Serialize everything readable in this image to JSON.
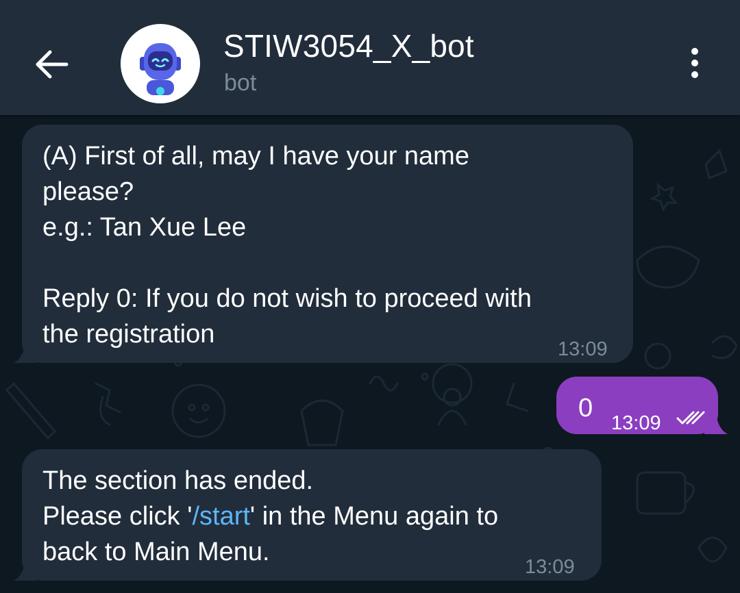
{
  "header": {
    "title": "STIW3054_X_bot",
    "subtitle": "bot"
  },
  "messages": [
    {
      "direction": "incoming",
      "text": "(A) First of all, may I have your name\nplease?\ne.g.: Tan Xue Lee\n\nReply 0: If you do not wish to proceed with\nthe registration",
      "time": "13:09"
    },
    {
      "direction": "outgoing",
      "text": "0",
      "time": "13:09",
      "status": "read"
    },
    {
      "direction": "incoming",
      "text_before_link": "The section has ended.\nPlease click '",
      "link": "/start",
      "text_after_link": "' in the Menu again to\nback to Main Menu.",
      "time": "13:09"
    }
  ],
  "colors": {
    "header_bg": "#212d3b",
    "incoming_bubble": "#212d3b",
    "outgoing_bubble": "#8b3ec0",
    "link": "#5eb5f7",
    "time_text": "#7d8b99"
  },
  "icons": {
    "back": "arrow-left-icon",
    "avatar": "robot-avatar-icon",
    "menu": "more-vertical-icon",
    "read_status": "double-check-icon"
  }
}
